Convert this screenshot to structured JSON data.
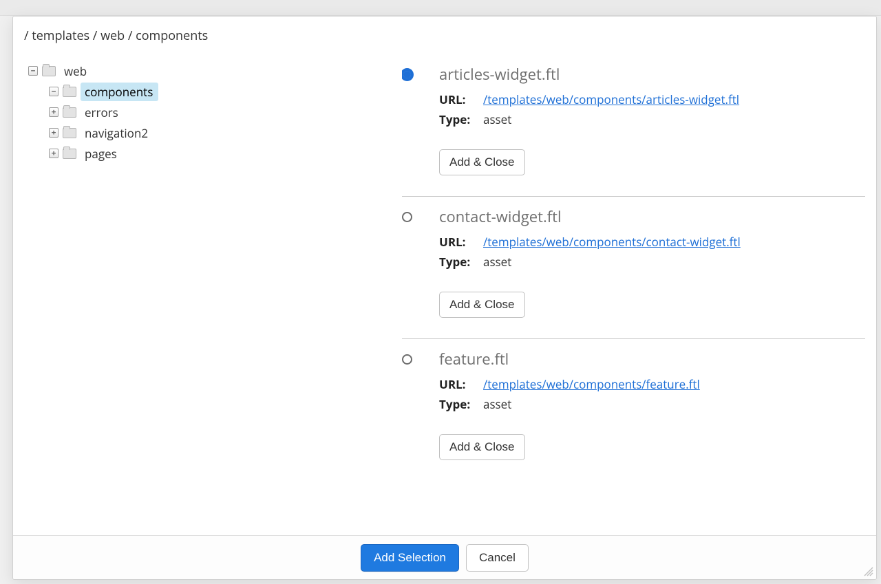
{
  "breadcrumb": "/ templates / web / components",
  "tree": {
    "root_label": "web",
    "root_toggle": "−",
    "children": [
      {
        "label": "components",
        "toggle": "−",
        "selected": true
      },
      {
        "label": "errors",
        "toggle": "+",
        "selected": false
      },
      {
        "label": "navigation2",
        "toggle": "+",
        "selected": false
      },
      {
        "label": "pages",
        "toggle": "+",
        "selected": false
      }
    ]
  },
  "labels": {
    "url": "URL:",
    "type": "Type:",
    "add_close": "Add & Close",
    "add_selection": "Add Selection",
    "cancel": "Cancel"
  },
  "items": [
    {
      "title": "articles-widget.ftl",
      "url": "/templates/web/components/articles-widget.ftl",
      "type": "asset",
      "selected": true
    },
    {
      "title": "contact-widget.ftl",
      "url": "/templates/web/components/contact-widget.ftl",
      "type": "asset",
      "selected": false
    },
    {
      "title": "feature.ftl",
      "url": "/templates/web/components/feature.ftl",
      "type": "asset",
      "selected": false
    }
  ]
}
